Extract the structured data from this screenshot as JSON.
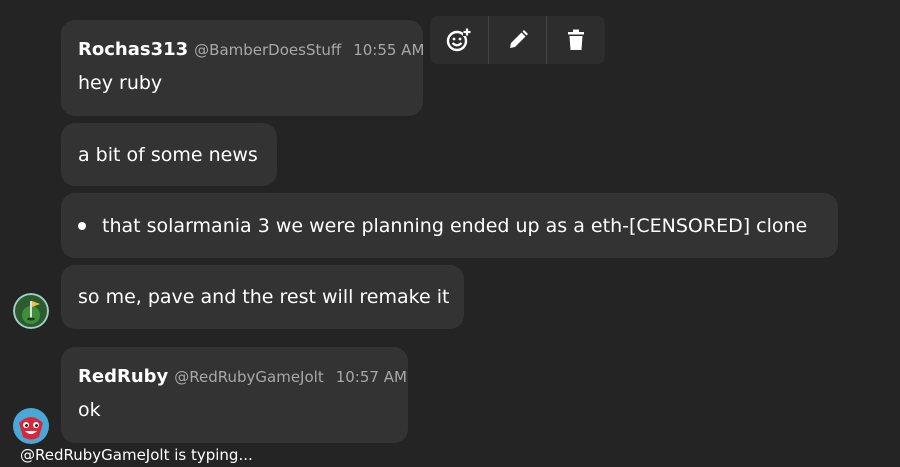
{
  "messages": {
    "m1": {
      "author": "Rochas313",
      "handle": "@BamberDoesStuff",
      "time": "10:55 AM",
      "text": "hey ruby"
    },
    "m2": {
      "text": "a bit of some news"
    },
    "m3": {
      "text": "that solarmania 3 we were planning ended up as a eth-[CENSORED] clone"
    },
    "m4": {
      "text": "so me, pave and the rest will remake it"
    },
    "m5": {
      "author": "RedRuby",
      "handle": "@RedRubyGameJolt",
      "time": "10:57 AM",
      "text": "ok"
    }
  },
  "toolbar": {
    "icons": [
      "add-reaction-icon",
      "pencil-icon",
      "trash-icon"
    ]
  },
  "typing_indicator": "@RedRubyGameJolt is typing..."
}
